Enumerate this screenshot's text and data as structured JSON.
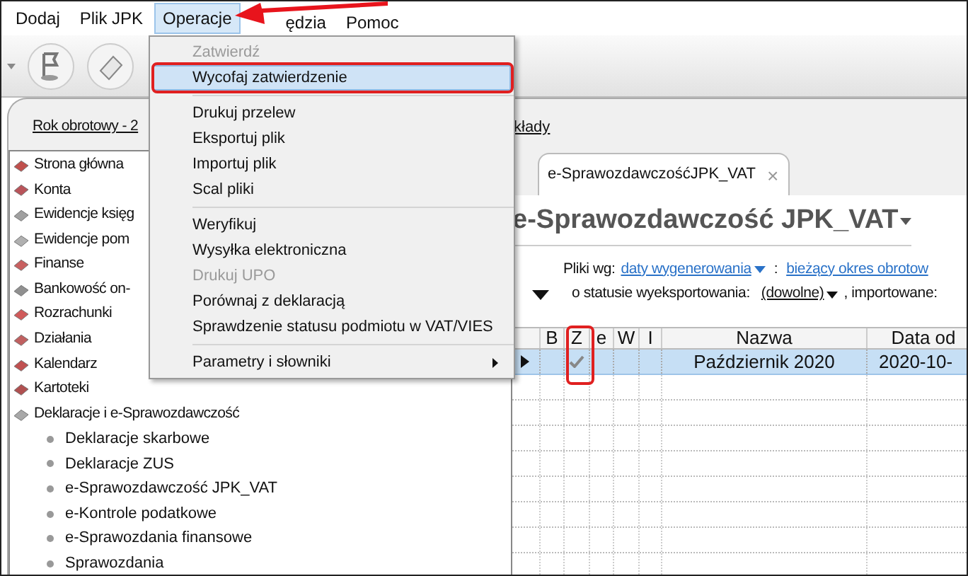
{
  "menubar": [
    {
      "label": "Dodaj",
      "selected": false
    },
    {
      "label": "Plik JPK",
      "selected": false
    },
    {
      "label": "Operacje",
      "selected": true
    },
    {
      "label": "ędzia",
      "selected": false
    },
    {
      "label": "Pomoc",
      "selected": false
    }
  ],
  "links": [
    "Rok obrotowy - 2",
    "kłady"
  ],
  "sidebar": {
    "items": [
      {
        "label": "Strona główna"
      },
      {
        "label": "Konta"
      },
      {
        "label": "Ewidencje księg"
      },
      {
        "label": "Ewidencje pom"
      },
      {
        "label": "Finanse"
      },
      {
        "label": "Bankowość on-"
      },
      {
        "label": "Rozrachunki"
      },
      {
        "label": "Działania"
      },
      {
        "label": "Kalendarz"
      },
      {
        "label": "Kartoteki"
      },
      {
        "label": "Deklaracje i e-Sprawozdawczość",
        "children": [
          {
            "label": "Deklaracje skarbowe"
          },
          {
            "label": "Deklaracje ZUS"
          },
          {
            "label": "e-Sprawozdawczość JPK_VAT"
          },
          {
            "label": "e-Kontrole podatkowe"
          },
          {
            "label": "e-Sprawozdania finansowe"
          },
          {
            "label": "Sprawozdania"
          }
        ]
      }
    ]
  },
  "tab": {
    "label": "e-SprawozdawczośćJPK_VAT",
    "close": "×"
  },
  "heading": "e-Sprawozdawczość JPK_VAT",
  "filters": {
    "label": "Pliki wg:",
    "by": "daty wygenerowania",
    "colon": ":",
    "period": "bieżący okres obrotow",
    "status_label": "o statusie wyeksportowania:",
    "status": "(dowolne)",
    "imported_label": ", importowane:"
  },
  "grid": {
    "columns": [
      "",
      "B",
      "Z",
      "e",
      "W",
      "I",
      "Nazwa",
      "Data od"
    ],
    "rows": [
      {
        "selected": true,
        "z_checked": true,
        "name": "Październik 2020",
        "date_from": "2020-10-"
      }
    ]
  },
  "menu": [
    {
      "kind": "item",
      "label": "Zatwierdź",
      "disabled": true,
      "selected": false
    },
    {
      "kind": "item",
      "label": "Wycofaj zatwierdzenie",
      "disabled": false,
      "selected": true
    },
    {
      "kind": "separator"
    },
    {
      "kind": "item",
      "label": "Drukuj przelew",
      "disabled": false,
      "selected": false
    },
    {
      "kind": "item",
      "label": "Eksportuj plik",
      "disabled": false,
      "selected": false
    },
    {
      "kind": "item",
      "label": "Importuj plik",
      "disabled": false,
      "selected": false
    },
    {
      "kind": "item",
      "label": "Scal pliki",
      "disabled": false,
      "selected": false
    },
    {
      "kind": "separator"
    },
    {
      "kind": "item",
      "label": "Weryfikuj",
      "disabled": false,
      "selected": false
    },
    {
      "kind": "item",
      "label": "Wysyłka elektroniczna",
      "disabled": false,
      "selected": false
    },
    {
      "kind": "item",
      "label": "Drukuj UPO",
      "disabled": true,
      "selected": false
    },
    {
      "kind": "item",
      "label": "Porównaj z deklaracją",
      "disabled": false,
      "selected": false
    },
    {
      "kind": "item",
      "label": "Sprawdzenie statusu podmiotu w VAT/VIES",
      "disabled": false,
      "selected": false
    },
    {
      "kind": "separator"
    },
    {
      "kind": "submenu",
      "label": "Parametry i słowniki",
      "disabled": false,
      "selected": false
    }
  ]
}
